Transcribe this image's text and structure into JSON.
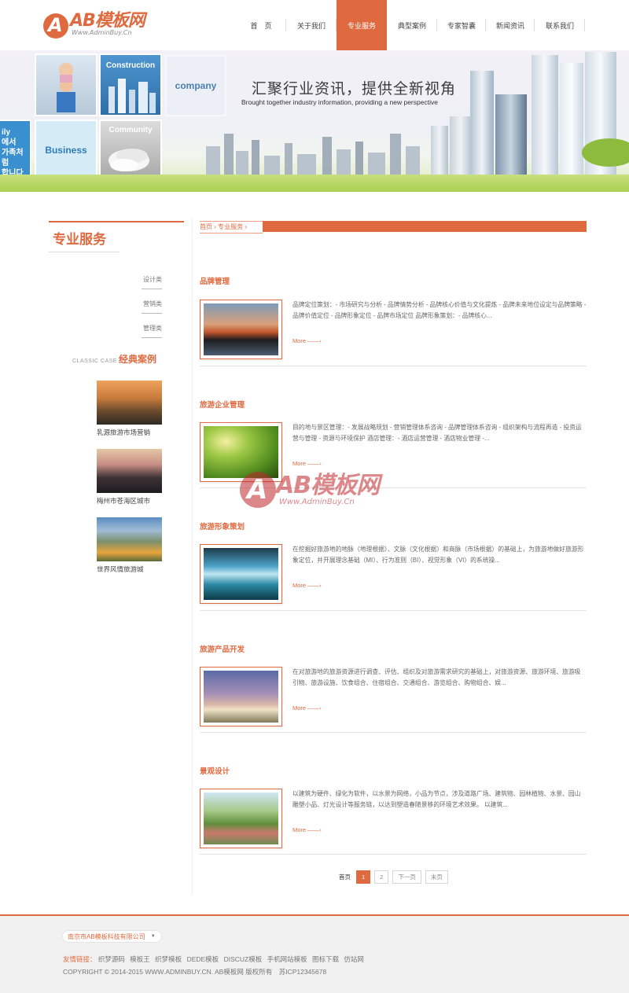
{
  "logo": {
    "name": "AB模板网",
    "url": "Www.AdminBuy.Cn"
  },
  "nav": [
    {
      "label": "首　页",
      "active": false
    },
    {
      "label": "关于我们",
      "active": false
    },
    {
      "label": "专业服务",
      "active": true
    },
    {
      "label": "典型案例",
      "active": false
    },
    {
      "label": "专家智囊",
      "active": false
    },
    {
      "label": "新闻资讯",
      "active": false
    },
    {
      "label": "联系我们",
      "active": false
    }
  ],
  "banner": {
    "title": "汇聚行业资讯，提供全新视角",
    "subtitle": "Brought together industry information, providing a new perspective",
    "tiles": {
      "construction": "Construction",
      "company": "company",
      "business": "Business",
      "community": "Community",
      "edge": "ily\n[에서\n가족처럼\n함니다"
    }
  },
  "sidebar": {
    "title": "专业服务",
    "items": [
      "设计类",
      "营销类",
      "管理类"
    ],
    "classic_en": "CLASSIC CASE",
    "classic_cn": "经典案例",
    "cases": [
      "乳源旅游市场营销",
      "梅州市苍海区城市",
      "世界风情旅游城"
    ]
  },
  "breadcrumb": {
    "home": "首页",
    "current": "专业服务",
    "sep": "›"
  },
  "articles": [
    {
      "title": "品牌管理",
      "desc": "品牌定位策划：- 市场研究与分析 - 品牌情势分析 - 品牌核心价值与文化提炼 - 品牌未来地位设定与品牌策略 - 品牌价值定位 - 品牌形象定位 - 品牌市场定位 品牌形象策划：- 品牌核心...",
      "more": "More"
    },
    {
      "title": "旅游企业管理",
      "desc": "目的地与景区管理：- 发展战略规划 - 营销管理体系咨询 - 品牌管理体系咨询 - 组织架构与流程再造 - 投资运营与管理 - 资源与环境保护 酒店管理：- 酒店运营管理 - 酒店物业管理 -...",
      "more": "More"
    },
    {
      "title": "旅游形象策划",
      "desc": "在挖掘好旅游地的地脉（地理根据）、文脉（文化根据）和商脉（市场根据）的基础上，为旅游地做好旅游形象定位，并开展理念基础（MI）、行为准则（BI）、视觉形象（VI）的系统操...",
      "more": "More"
    },
    {
      "title": "旅游产品开发",
      "desc": "在对旅游地的旅游资源进行调查、评估、组织及对旅游需求研究的基础上，对旅游资源、旅游环境、旅游吸引物、旅游设施、饮食组合、住宿组合、交通组合、游览组合、购物组合、娱...",
      "more": "More"
    },
    {
      "title": "景观设计",
      "desc": "以建筑为硬件、绿化为软件，以水景为网络，小品为节点，涉及道路广场、建筑物、园林植物、水景、园山雕塑小品、灯光设计等服务链，以达到塑造春随景移的环境艺术效果。 以建筑...",
      "more": "More"
    }
  ],
  "pager": {
    "first": "首页",
    "pages": [
      "1",
      "2"
    ],
    "current": "1",
    "next": "下一页",
    "last": "末页"
  },
  "watermark": {
    "name": "AB模板网",
    "url": "Www.AdminBuy.Cn"
  },
  "footer": {
    "company_select": "南京市AB模板科技有限公司",
    "links_label": "友情链接：",
    "links": [
      "织梦源码",
      "模板王",
      "织梦模板",
      "DEDE模板",
      "DISCUZ模板",
      "手机网站模板",
      "图标下载",
      "仿站网"
    ],
    "copyright": "COPYRIGHT © 2014-2015 WWW.ADMINBUY.CN. AB模板网 版权所有　苏ICP12345678"
  },
  "colors": {
    "accent": "#e06a3f",
    "watermark": "#c0262c"
  }
}
